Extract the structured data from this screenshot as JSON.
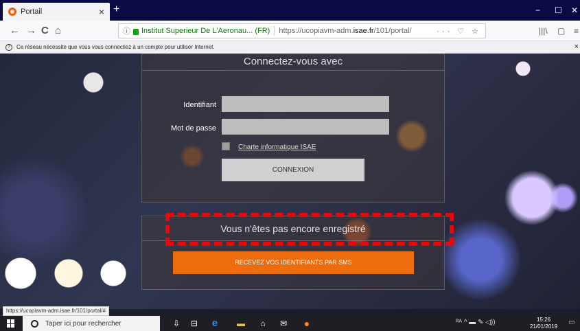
{
  "browser": {
    "tab_title": "Portail",
    "tab_close": "×",
    "new_tab": "+",
    "win_min": "−",
    "win_max": "☐",
    "win_close": "✕",
    "nav_back": "←",
    "nav_forward": "→",
    "nav_reload": "C",
    "nav_home": "⌂",
    "url_org": "Institut Superieur De L'Aeronau... (FR)",
    "url_prefix": "https://ucopiavm-adm.",
    "url_domain": "isae.fr",
    "url_suffix": "/101/portal/",
    "url_actions": "··· ♡ ☆",
    "library_btn": "|||\\",
    "sidebar_btn": "▢",
    "menu_btn": "≡"
  },
  "infobar": {
    "icon": "?",
    "message": "Ce réseau nécessite que vous vous connectiez à un compte pour utiliser Internet.",
    "close": "×"
  },
  "login": {
    "title": "Connectez-vous avec",
    "username_label": "Identifiant",
    "password_label": "Mot de passe",
    "charter_link": "Charte informatique ISAE",
    "connect_button": "CONNEXION"
  },
  "register": {
    "title": "Vous n'êtes pas encore enregistré",
    "sms_button": "RECEVEZ VOS IDENTIFIANTS PAR SMS"
  },
  "status_url": "https://ucopiavm-adm.isae.fr/101/portal/#",
  "taskbar": {
    "search_placeholder": "Taper ici pour rechercher",
    "tray_text": "ᴿᴬ  ^  ▬  ✎  ◁))",
    "time": "15:26",
    "date": "21/01/2019",
    "notif": "▭"
  },
  "colors": {
    "accent_orange": "#ec6c0e",
    "highlight_red": "#e8080c",
    "taskbar_bg": "#1e1e24"
  }
}
